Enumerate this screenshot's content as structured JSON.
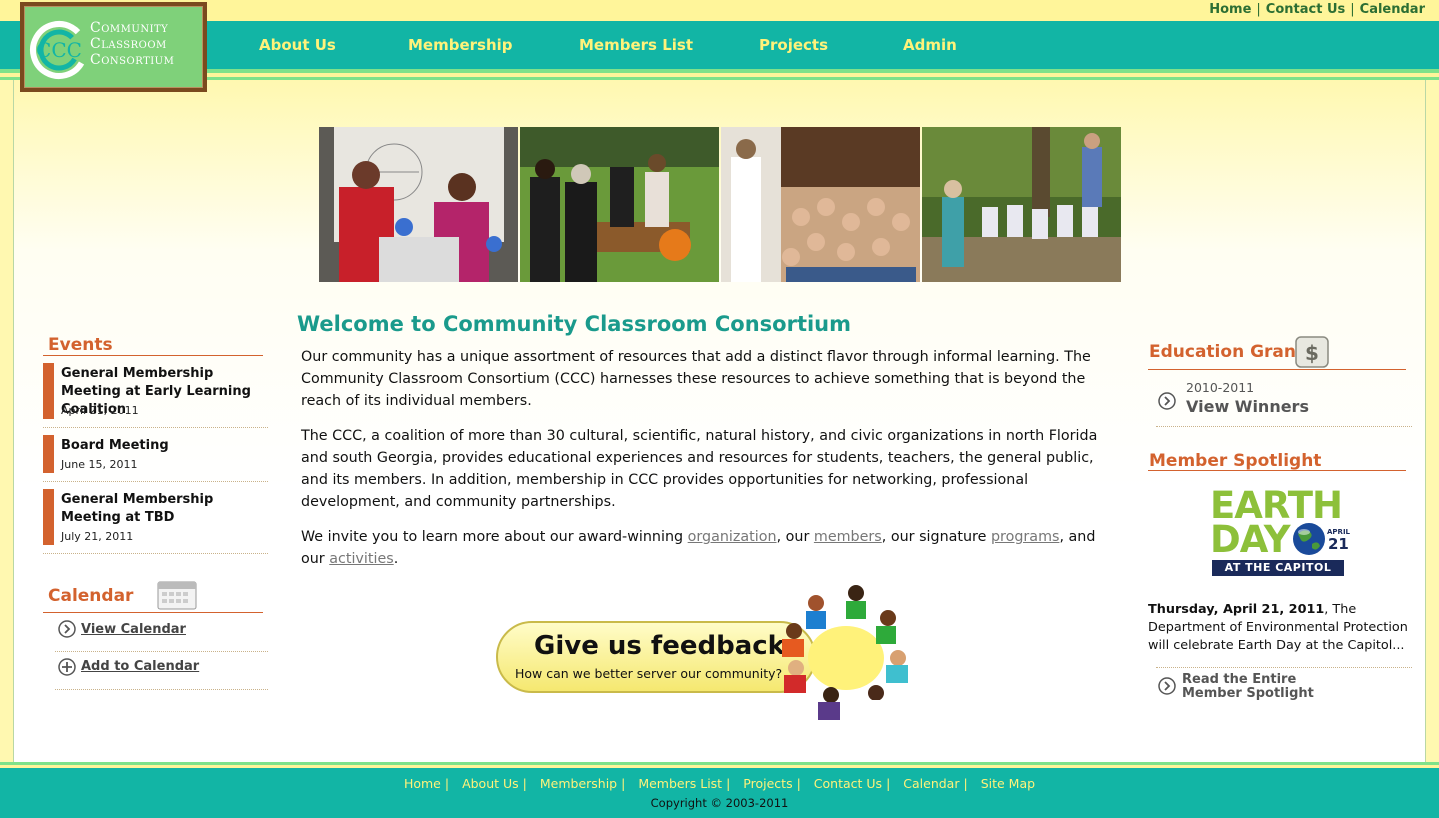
{
  "utility": {
    "home": "Home",
    "contact": "Contact Us",
    "calendar": "Calendar",
    "separator": "|"
  },
  "logo": {
    "initials": "CCC",
    "line1": "Community",
    "line2": "Classroom",
    "line3": "Consortium"
  },
  "nav": {
    "about": "About Us",
    "membership": "Membership",
    "members_list": "Members List",
    "projects": "Projects",
    "admin": "Admin"
  },
  "main": {
    "title": "Welcome to Community Classroom Consortium",
    "p1": "Our community has a unique assortment of resources that add a distinct flavor through informal learning. The Community Classroom Consortium (CCC) harnesses these resources to achieve something that is beyond the reach of its individual members.",
    "p2": "The CCC, a coalition of more than 30 cultural, scientific, natural history, and civic organizations in north Florida and south Georgia, provides educational experiences and resources for students, teachers, the general public, and its members. In addition, membership in CCC provides opportunities for networking, professional development, and community partnerships.",
    "p3_a": "We invite you to learn more about our award-winning ",
    "link_organization": "organization",
    "p3_b": ", our ",
    "link_members": "members",
    "p3_c": ", our signature ",
    "link_programs": "programs",
    "p3_d": ", and our ",
    "link_activities": "activities",
    "p3_e": "."
  },
  "events": {
    "heading": "Events",
    "items": [
      {
        "title": "General Membership Meeting at Early Learning Coalition",
        "date": "April 21, 2011"
      },
      {
        "title": "Board Meeting",
        "date": "June 15, 2011"
      },
      {
        "title": "General Membership Meeting at TBD",
        "date": "July 21, 2011"
      }
    ]
  },
  "calendar": {
    "heading": "Calendar",
    "view": "View Calendar",
    "add": "Add to Calendar"
  },
  "feedback": {
    "title": "Give us feedback",
    "subtitle": "How can we better server our community?"
  },
  "grant": {
    "heading": "Education Grant",
    "years": "2010-2011",
    "link": "View Winners"
  },
  "spotlight": {
    "heading": "Member Spotlight",
    "earth_line1": "EARTH",
    "earth_line2": "DAY",
    "earth_month": "APRIL",
    "earth_day": "21",
    "earth_banner": "AT THE CAPITOL",
    "date_bold": "Thursday, April 21, 2011",
    "text": ", The Department of Environmental Protection will celebrate Earth Day at the Capitol...",
    "read_line1": "Read the Entire",
    "read_line2": "Member Spotlight"
  },
  "footer": {
    "links": [
      "Home",
      "About Us",
      "Membership",
      "Members List",
      "Projects",
      "Contact Us",
      "Calendar",
      "Site Map"
    ],
    "separator": "|",
    "copyright": "Copyright © 2003-2011"
  },
  "colors": {
    "teal": "#12b5a5",
    "yellow": "#fff59a",
    "orange": "#d3622e",
    "nav_text": "#fff27a",
    "heading_teal": "#1a9a8c"
  }
}
